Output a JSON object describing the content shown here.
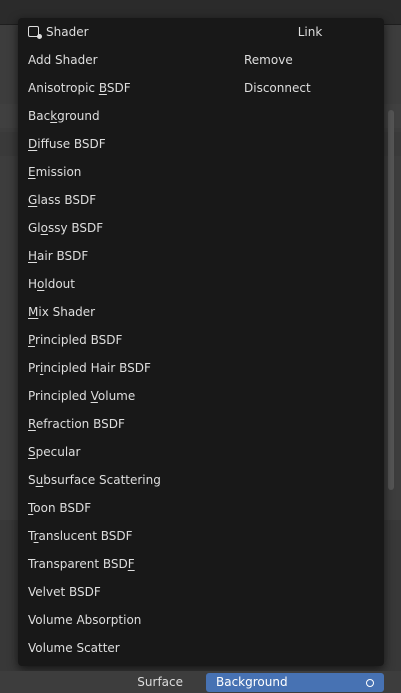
{
  "menu": {
    "header": "Shader",
    "items": [
      {
        "label": "Add Shader",
        "u": ""
      },
      {
        "label": "Anisotropic BSDF",
        "u": "B"
      },
      {
        "label": "Background",
        "u": "k"
      },
      {
        "label": "Diffuse BSDF",
        "u": "D"
      },
      {
        "label": "Emission",
        "u": "E"
      },
      {
        "label": "Glass BSDF",
        "u": "G"
      },
      {
        "label": "Glossy BSDF",
        "u": "o"
      },
      {
        "label": "Hair BSDF",
        "u": "H"
      },
      {
        "label": "Holdout",
        "u": "o"
      },
      {
        "label": "Mix Shader",
        "u": "M"
      },
      {
        "label": "Principled BSDF",
        "u": "P"
      },
      {
        "label": "Principled Hair BSDF",
        "u": "i"
      },
      {
        "label": "Principled Volume",
        "u": "V"
      },
      {
        "label": "Refraction BSDF",
        "u": "R"
      },
      {
        "label": "Specular",
        "u": "S"
      },
      {
        "label": "Subsurface Scattering",
        "u": "u"
      },
      {
        "label": "Toon BSDF",
        "u": "T"
      },
      {
        "label": "Translucent BSDF",
        "u": "r"
      },
      {
        "label": "Transparent BSDF",
        "u": "F"
      },
      {
        "label": "Velvet BSDF",
        "u": ""
      },
      {
        "label": "Volume Absorption",
        "u": ""
      },
      {
        "label": "Volume Scatter",
        "u": ""
      }
    ],
    "link": {
      "header": "Link",
      "items": [
        "Remove",
        "Disconnect"
      ]
    }
  },
  "surface": {
    "label": "Surface",
    "value": "Background"
  },
  "colors": {
    "menu_bg": "#181818",
    "highlight": "#4772b3"
  },
  "icons": [
    "shader-icon",
    "socket-dot-icon"
  ]
}
